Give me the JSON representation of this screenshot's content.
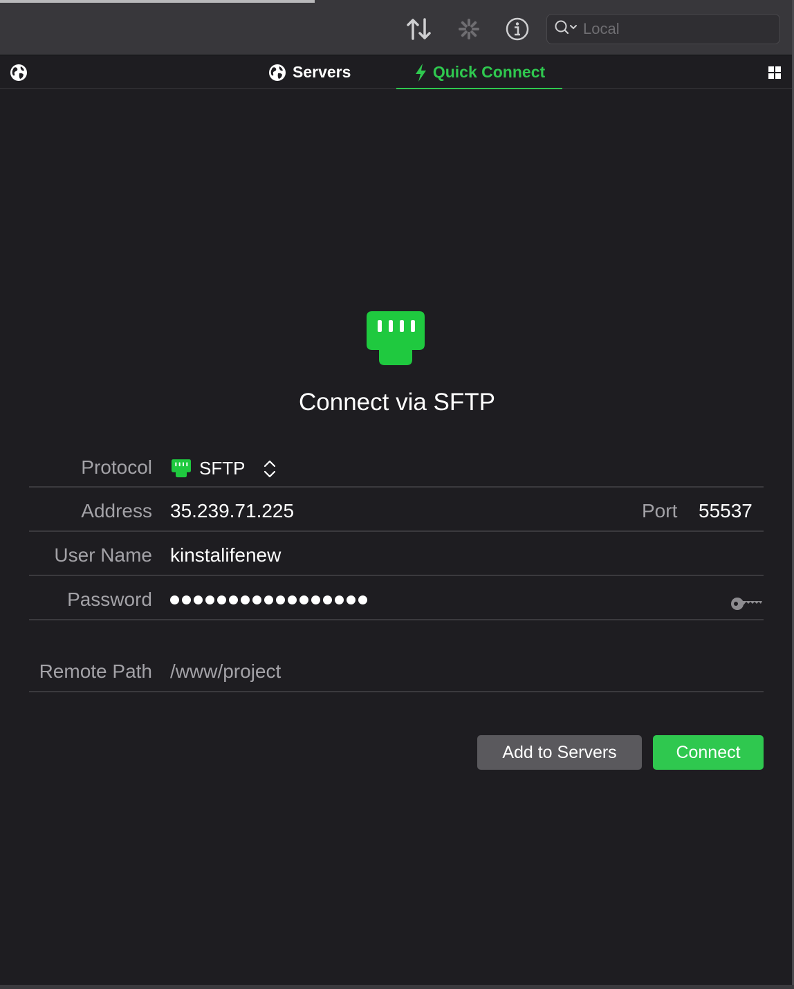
{
  "toolbar": {
    "icons": [
      "transfer-arrows-icon",
      "activity-spinner-icon",
      "info-icon"
    ],
    "search_placeholder": "Local"
  },
  "tabs": {
    "servers_label": "Servers",
    "quick_connect_label": "Quick Connect",
    "active": "Quick Connect"
  },
  "main": {
    "title": "Connect via SFTP"
  },
  "form": {
    "protocol_label": "Protocol",
    "protocol_value": "SFTP",
    "address_label": "Address",
    "address_value": "35.239.71.225",
    "port_label": "Port",
    "port_value": "55537",
    "username_label": "User Name",
    "username_value": "kinstalifenew",
    "password_label": "Password",
    "password_masked_length": 17,
    "remote_path_label": "Remote Path",
    "remote_path_placeholder": "/www/project"
  },
  "buttons": {
    "add_to_servers": "Add to Servers",
    "connect": "Connect"
  },
  "colors": {
    "accent_green": "#2fc84f",
    "background": "#1e1d21",
    "toolbar": "#38373b"
  }
}
